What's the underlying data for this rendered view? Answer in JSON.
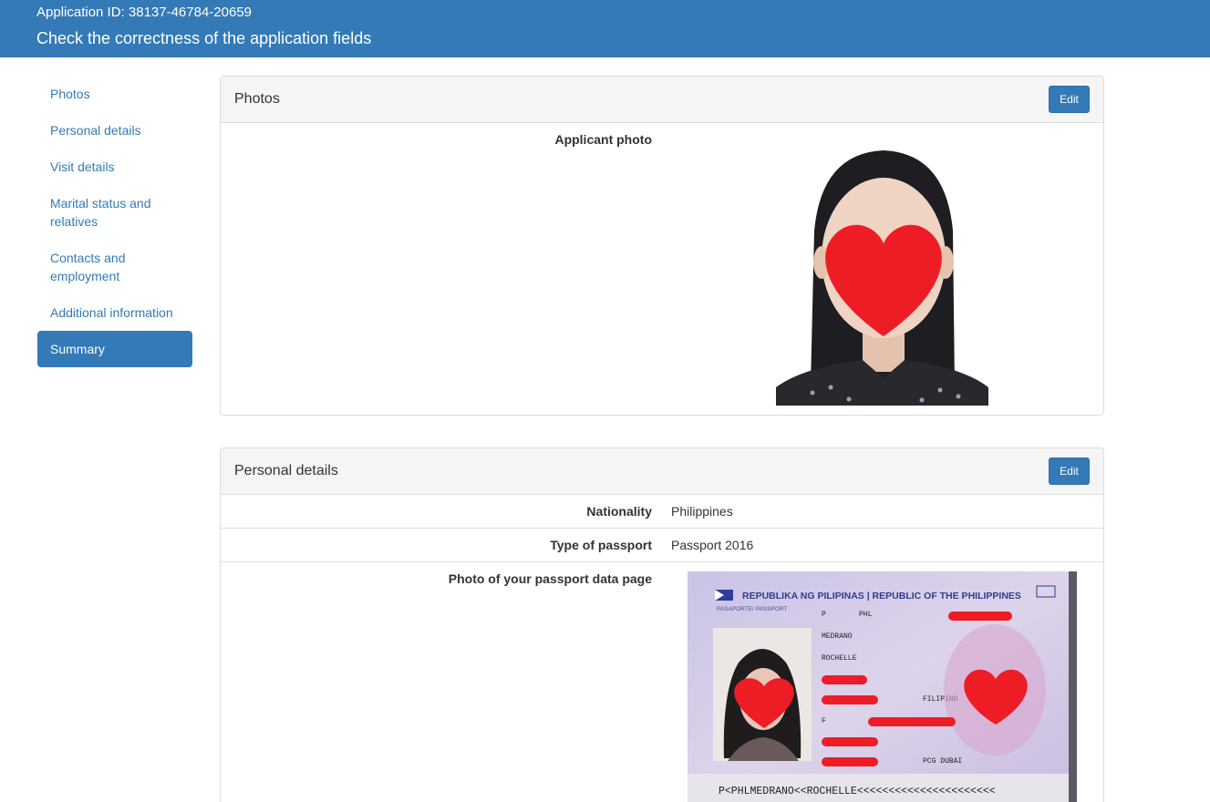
{
  "header": {
    "application_id": "Application ID: 38137-46784-20659",
    "title": "Check the correctness of the application fields"
  },
  "sidebar": {
    "items": [
      {
        "label": "Photos"
      },
      {
        "label": "Personal details"
      },
      {
        "label": "Visit details"
      },
      {
        "label": "Marital status and relatives"
      },
      {
        "label": "Contacts and employment"
      },
      {
        "label": "Additional information"
      },
      {
        "label": "Summary",
        "active": true
      }
    ]
  },
  "photos_panel": {
    "title": "Photos",
    "edit_label": "Edit",
    "applicant_photo_label": "Applicant photo"
  },
  "personal_panel": {
    "title": "Personal details",
    "edit_label": "Edit",
    "fields": [
      {
        "label": "Nationality",
        "value": "Philippines"
      },
      {
        "label": "Type of passport",
        "value": "Passport 2016"
      }
    ],
    "passport_photo_label": "Photo of your passport data page",
    "passport_image": {
      "header": "REPUBLIKA NG PILIPINAS | REPUBLIC OF THE PHILIPPINES",
      "doc_type_label": "PASAPORTE/ PASSPORT",
      "type": "P",
      "country_code": "PHL",
      "surname": "MEDRANO",
      "given_name": "ROCHELLE",
      "nationality": "FILIPINO",
      "sex": "F",
      "issuing_authority": "PCG DUBAI",
      "mrz": "P<PHLMEDRANO<<ROCHELLE<<<<<<<<<<<<<<<<<<<<<<"
    }
  },
  "colors": {
    "primary": "#337ab7",
    "redaction": "#ee1c25",
    "panel_heading_bg": "#f5f5f5",
    "border": "#dddddd"
  }
}
